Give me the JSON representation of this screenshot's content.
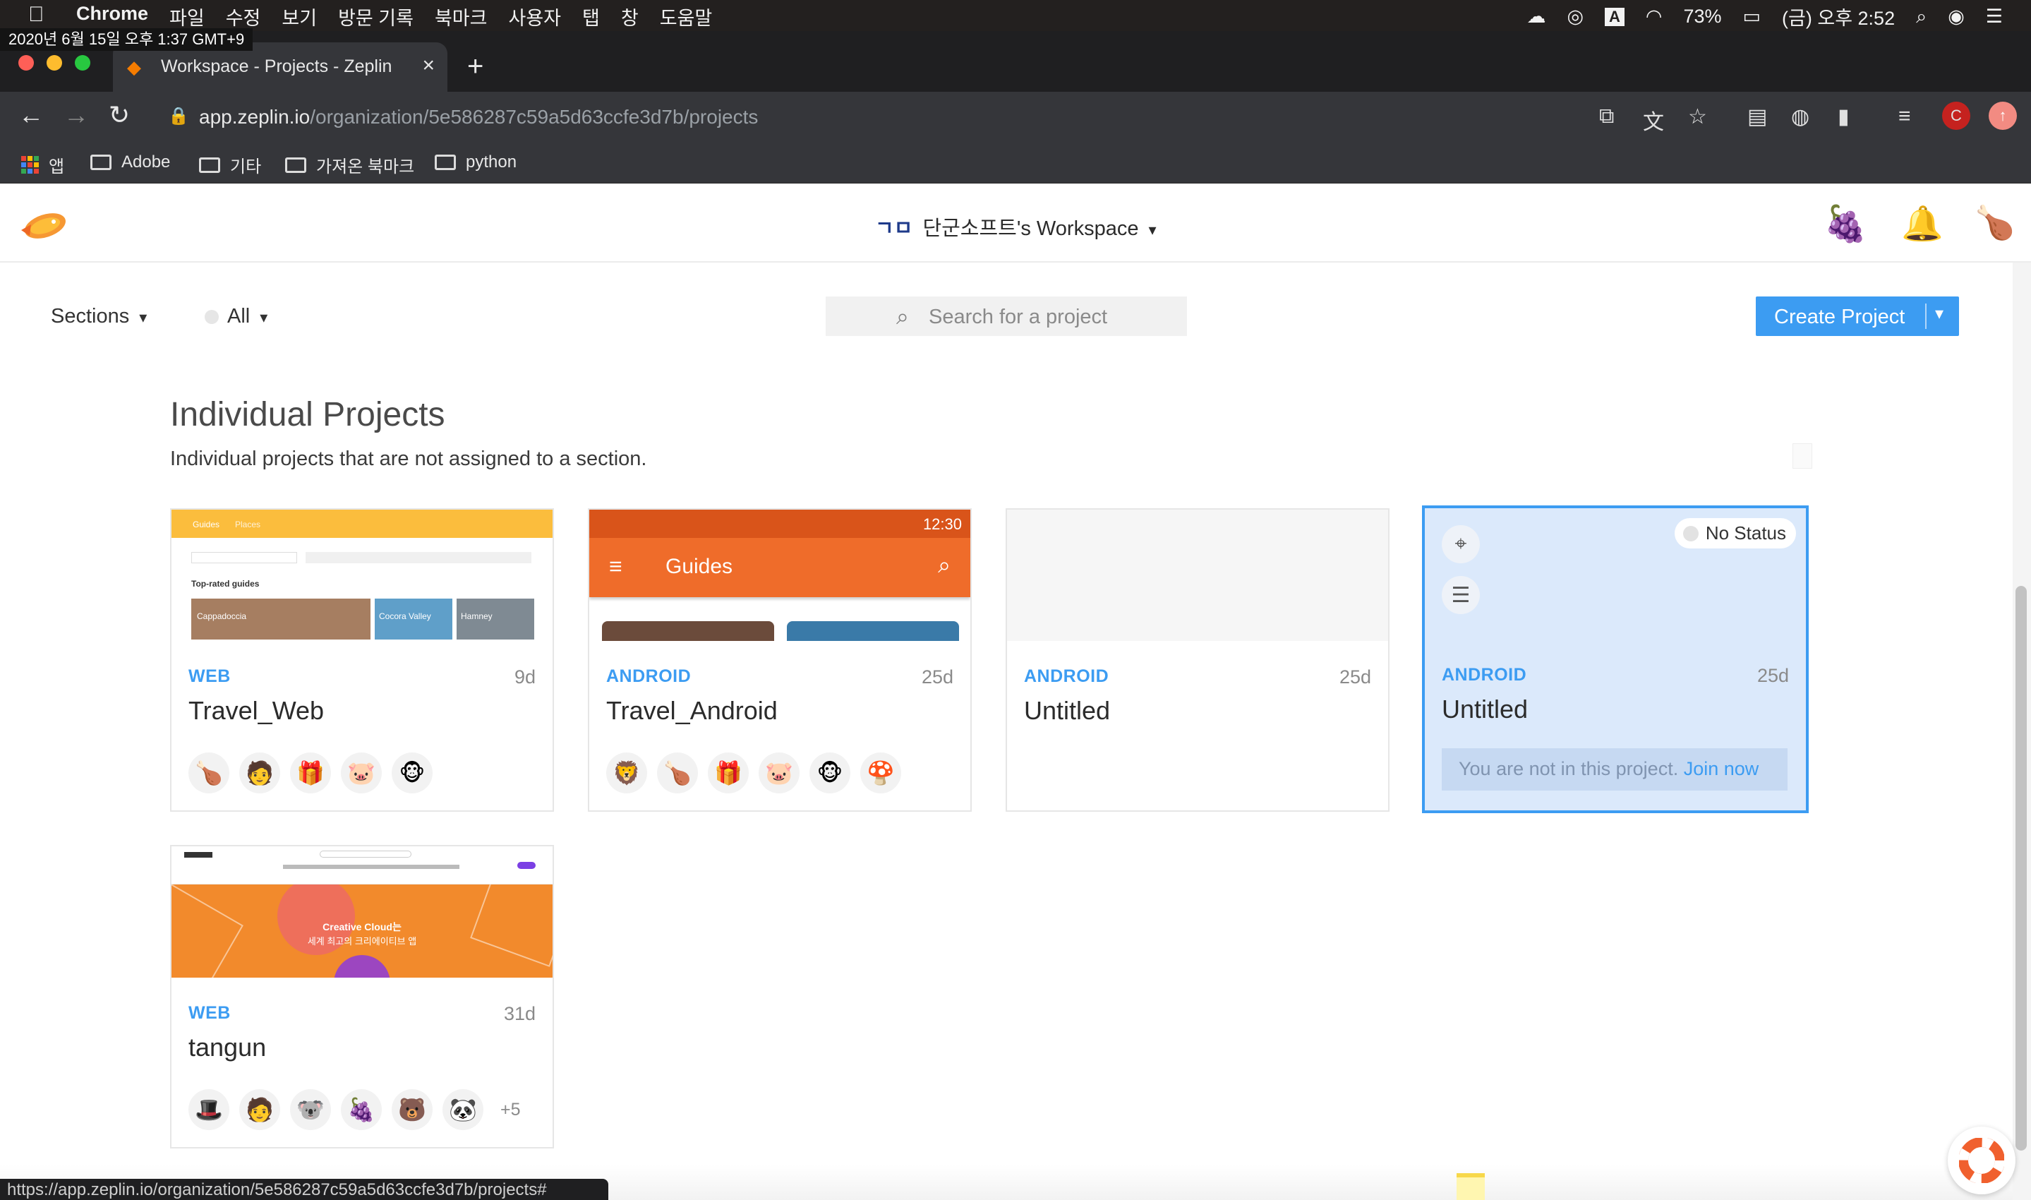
{
  "menubar": {
    "app": "Chrome",
    "items": [
      "파일",
      "수정",
      "보기",
      "방문 기록",
      "북마크",
      "사용자",
      "탭",
      "창",
      "도움말"
    ],
    "battery": "73%",
    "clock": "(금) 오후 2:52",
    "tooltip": "2020년 6월 15일 오후 1:37 GMT+9"
  },
  "browser": {
    "tab_title": "Workspace - Projects - Zeplin",
    "url_host": "app.zeplin.io",
    "url_path": "/organization/5e586287c59a5d63ccfe3d7b/projects",
    "profile_initial": "C",
    "bookmarks": [
      "앱",
      "Adobe",
      "기타",
      "가져온 북마크",
      "python"
    ],
    "status_url": "https://app.zeplin.io/organization/5e586287c59a5d63ccfe3d7b/projects#"
  },
  "header": {
    "workspace_mark": "ㄱㅁ",
    "workspace_name": "단군소프트's Workspace"
  },
  "toolbar": {
    "sections_label": "Sections",
    "filter_label": "All",
    "search_placeholder": "Search for a project",
    "create_label": "Create Project"
  },
  "section": {
    "title": "Individual Projects",
    "description": "Individual projects that are not assigned to a section."
  },
  "projects": [
    {
      "platform": "WEB",
      "age": "9d",
      "name": "Travel_Web",
      "avatars": [
        "🍗",
        "🧑",
        "🎁",
        "🐷",
        "🐵"
      ],
      "more": "",
      "thumb": {
        "tabs": [
          "Guides",
          "Places"
        ],
        "heading": "Top-rated guides",
        "cards": [
          "Cappadoccia",
          "Cocora Valley",
          "Hamney"
        ]
      }
    },
    {
      "platform": "ANDROID",
      "age": "25d",
      "name": "Travel_Android",
      "avatars": [
        "🦁",
        "🍗",
        "🎁",
        "🐷",
        "🐵",
        "🍄"
      ],
      "more": "",
      "thumb": {
        "time": "12:30",
        "title": "Guides"
      }
    },
    {
      "platform": "ANDROID",
      "age": "25d",
      "name": "Untitled",
      "avatars": [],
      "more": ""
    },
    {
      "platform": "ANDROID",
      "age": "25d",
      "name": "Untitled",
      "status": "No Status",
      "join_text": "You are not in this project.",
      "join_link": "Join now"
    },
    {
      "platform": "WEB",
      "age": "31d",
      "name": "tangun",
      "avatars": [
        "🎩",
        "🧑",
        "🐨",
        "🍇",
        "🐻",
        "🐼"
      ],
      "more": "+5",
      "thumb": {
        "banner_line1": "Creative Cloud는",
        "banner_line2": "세계 최고의 크리에이티브 앱"
      }
    }
  ],
  "colors": {
    "accent": "#3c9cf2",
    "selected_bg": "#dbe9fb",
    "thumb_orange": "#ef6c2a"
  }
}
